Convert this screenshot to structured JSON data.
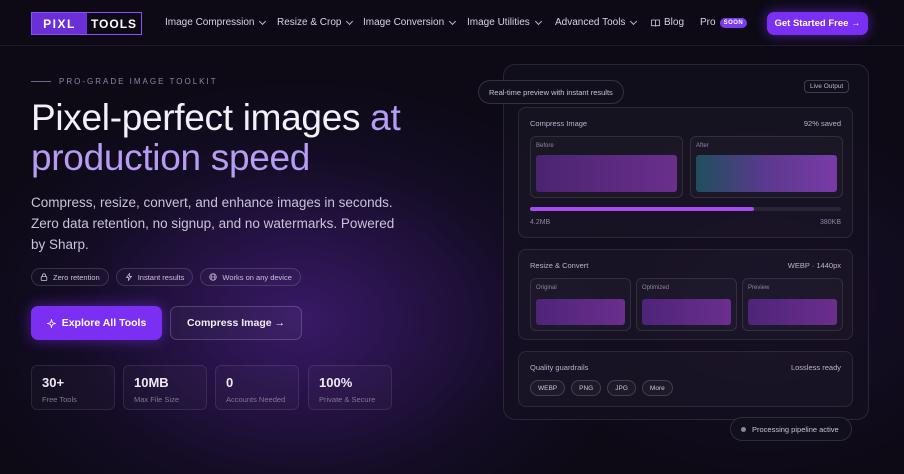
{
  "logo": {
    "part1": "PIXL",
    "part2": "TOOLS"
  },
  "nav": {
    "items": [
      "Image Compression",
      "Resize & Crop",
      "Image Conversion",
      "Image Utilities",
      "Advanced Tools"
    ],
    "blog": "Blog",
    "pro": "Pro",
    "soon_badge": "SOON",
    "cta": "Get Started Free →"
  },
  "hero": {
    "eyebrow": "PRO-GRADE IMAGE TOOLKIT",
    "title_main": "Pixel-perfect images ",
    "title_accent1": "at",
    "title_accent2": "production speed",
    "subtitle": "Compress, resize, convert, and enhance images in seconds. Zero data retention, no signup, and no watermarks. Powered by Sharp.",
    "chips": [
      "Zero retention",
      "Instant results",
      "Works on any device"
    ],
    "primary_button": "Explore All Tools",
    "secondary_button": "Compress Image →",
    "stats": [
      {
        "value": "30+",
        "label": "Free Tools"
      },
      {
        "value": "10MB",
        "label": "Max File Size"
      },
      {
        "value": "0",
        "label": "Accounts Needed"
      },
      {
        "value": "100%",
        "label": "Private & Secure"
      }
    ]
  },
  "preview": {
    "pill": "Real-time preview with instant results",
    "live": "Live Output",
    "compress": {
      "title": "Compress Image",
      "saved": "92% saved",
      "before": "Before",
      "after": "After",
      "from": "4.2MB",
      "to": "380KB",
      "progress": 0.72
    },
    "resize": {
      "title": "Resize & Convert",
      "spec": "WEBP · 1440px",
      "slots": [
        "Original",
        "Optimized",
        "Preview"
      ]
    },
    "quality": {
      "title": "Quality guardrails",
      "status": "Lossless ready",
      "formats": [
        "WEBP",
        "PNG",
        "JPG",
        "More"
      ]
    },
    "pipeline": "Processing pipeline active"
  },
  "colors": {
    "accent": "#7b2ff2",
    "accent_text": "#b69cf2"
  }
}
